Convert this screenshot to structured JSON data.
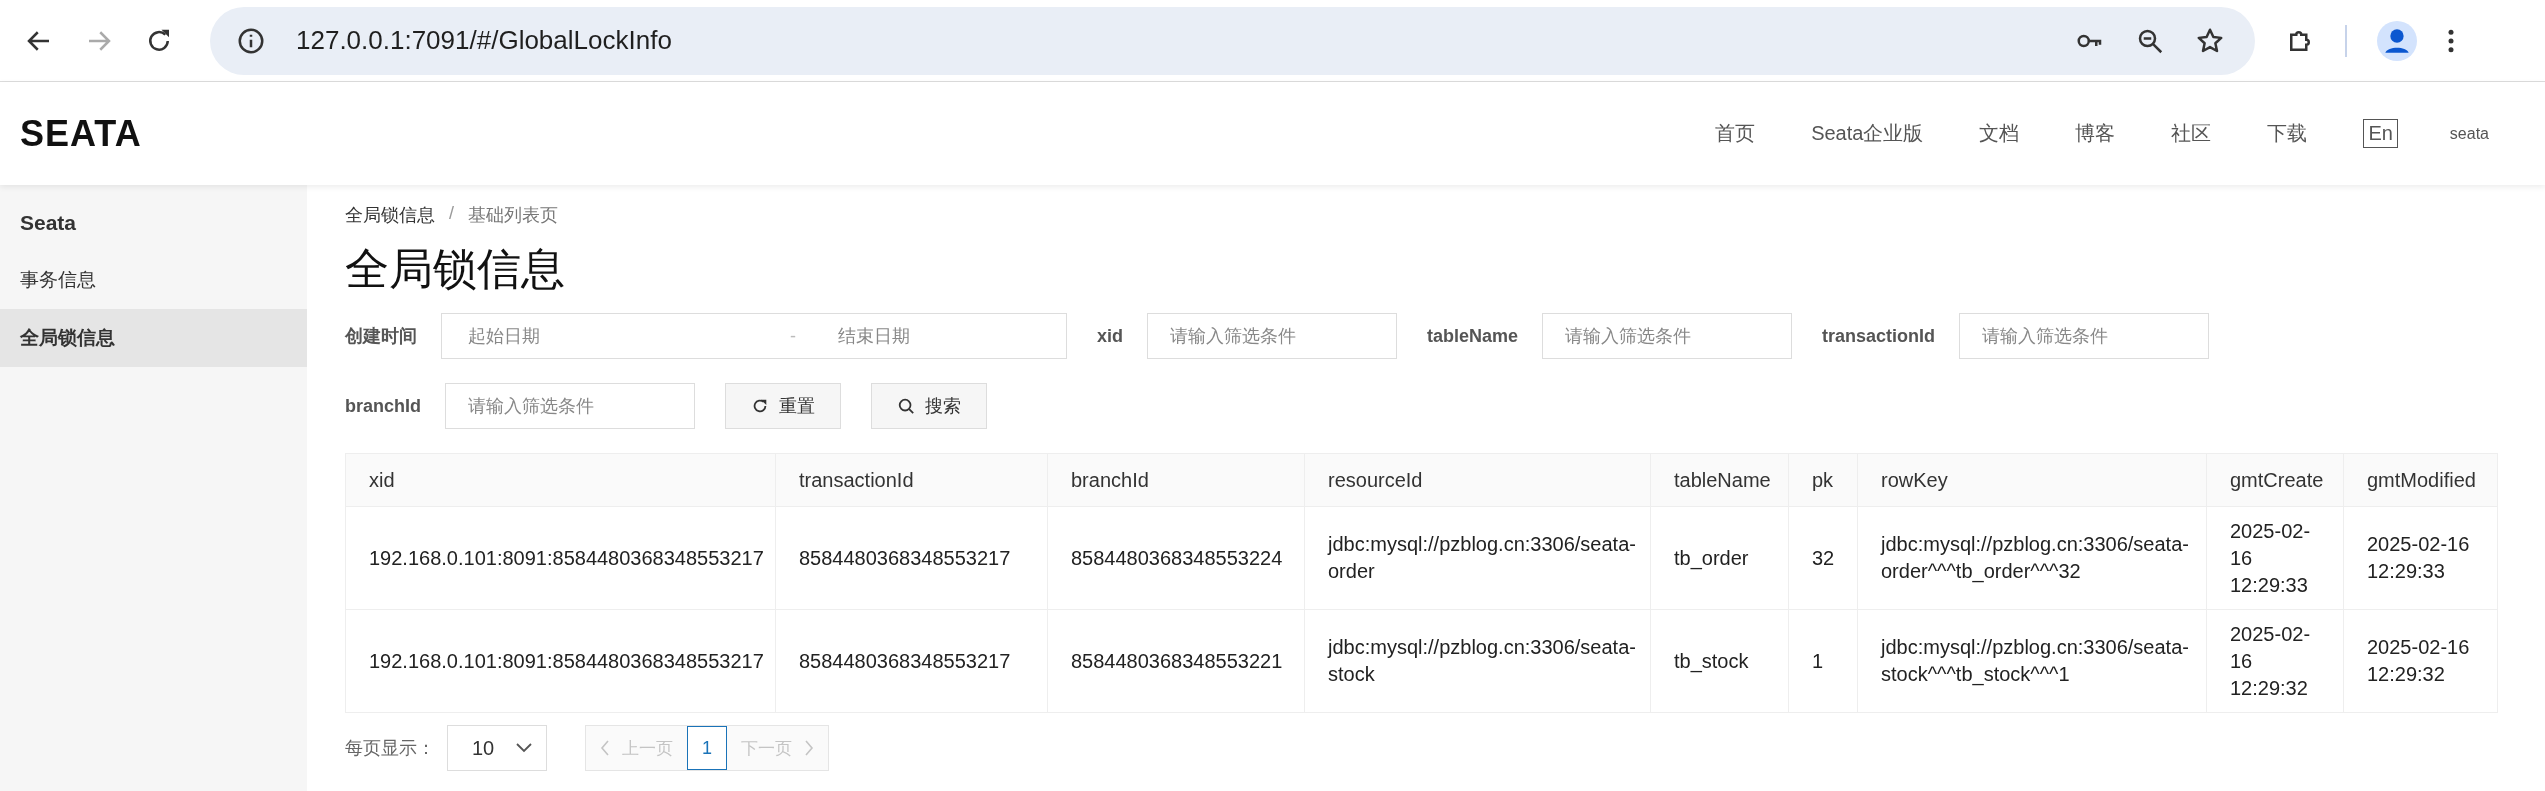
{
  "browser": {
    "url": "127.0.0.1:7091/#/GlobalLockInfo"
  },
  "header": {
    "logo": "SEATA",
    "nav": [
      "首页",
      "Seata企业版",
      "文档",
      "博客",
      "社区",
      "下载"
    ],
    "lang": "En",
    "user": "seata"
  },
  "sidebar": {
    "title": "Seata",
    "items": [
      {
        "label": "事务信息",
        "selected": false
      },
      {
        "label": "全局锁信息",
        "selected": true
      }
    ]
  },
  "breadcrumb": {
    "separator": "/",
    "items": [
      "全局锁信息",
      "基础列表页"
    ]
  },
  "page_title": "全局锁信息",
  "filters": [
    {
      "kind": "daterange",
      "label": "创建时间",
      "start_placeholder": "起始日期",
      "separator": "-",
      "end_placeholder": "结束日期"
    },
    {
      "kind": "text",
      "label": "xid",
      "placeholder": "请输入筛选条件"
    },
    {
      "kind": "text",
      "label": "tableName",
      "placeholder": "请输入筛选条件"
    },
    {
      "kind": "text",
      "label": "transactionId",
      "placeholder": "请输入筛选条件"
    },
    {
      "kind": "text",
      "label": "branchId",
      "placeholder": "请输入筛选条件"
    }
  ],
  "buttons": [
    {
      "kind": "reset",
      "label": "重置"
    },
    {
      "kind": "search",
      "label": "搜索"
    }
  ],
  "table": {
    "columns": [
      "xid",
      "transactionId",
      "branchId",
      "resourceId",
      "tableName",
      "pk",
      "rowKey",
      "gmtCreate",
      "gmtModified"
    ],
    "rows": [
      [
        "192.168.0.101:8091:8584480368348553217",
        "8584480368348553217",
        "8584480368348553224",
        "jdbc:mysql://pzblog.cn:3306/seata-order",
        "tb_order",
        "32",
        "jdbc:mysql://pzblog.cn:3306/seata-order^^^tb_order^^^32",
        "2025-02-16 12:29:33",
        "2025-02-16 12:29:33"
      ],
      [
        "192.168.0.101:8091:8584480368348553217",
        "8584480368348553217",
        "8584480368348553221",
        "jdbc:mysql://pzblog.cn:3306/seata-stock",
        "tb_stock",
        "1",
        "jdbc:mysql://pzblog.cn:3306/seata-stock^^^tb_stock^^^1",
        "2025-02-16 12:29:32",
        "2025-02-16 12:29:32"
      ]
    ]
  },
  "pagination": {
    "page_size_label": "每页显示：",
    "page_size": "10",
    "prev": {
      "label": "上一页",
      "disabled": true
    },
    "pages": [
      {
        "label": "1",
        "selected": true
      }
    ],
    "next": {
      "label": "下一页",
      "disabled": true
    }
  }
}
